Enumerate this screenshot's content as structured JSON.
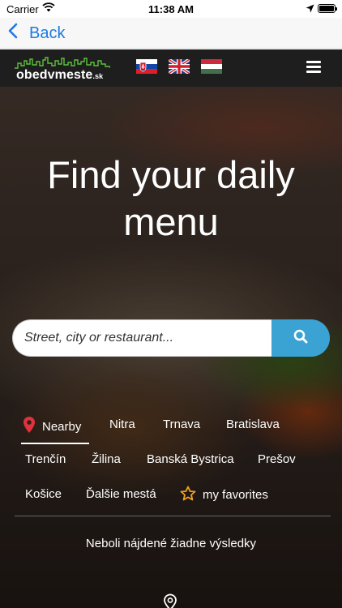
{
  "status_bar": {
    "carrier": "Carrier",
    "time": "11:38 AM"
  },
  "nav": {
    "back_label": "Back"
  },
  "header": {
    "logo_text": "obedvmeste",
    "logo_tld": ".sk",
    "flags": [
      "slovak-flag-icon",
      "uk-flag-icon",
      "hungarian-flag-icon"
    ]
  },
  "hero": {
    "headline_line1": "Find your daily",
    "headline_line2": "menu"
  },
  "search": {
    "placeholder": "Street, city or restaurant..."
  },
  "tabs": {
    "nearby": "Nearby",
    "items": [
      "Nitra",
      "Trnava",
      "Bratislava",
      "Trenčín",
      "Žilina",
      "Banská Bystrica",
      "Prešov",
      "Košice",
      "Ďalšie mestá"
    ],
    "favorites": "my favorites"
  },
  "results": {
    "empty_message": "Neboli nájdené žiadne výsledky"
  },
  "colors": {
    "accent": "#3aa3d4",
    "link": "#1a7ae5",
    "pin_red": "#e0323c",
    "star": "#f0a21e",
    "header_bg": "#1e1e1e"
  }
}
